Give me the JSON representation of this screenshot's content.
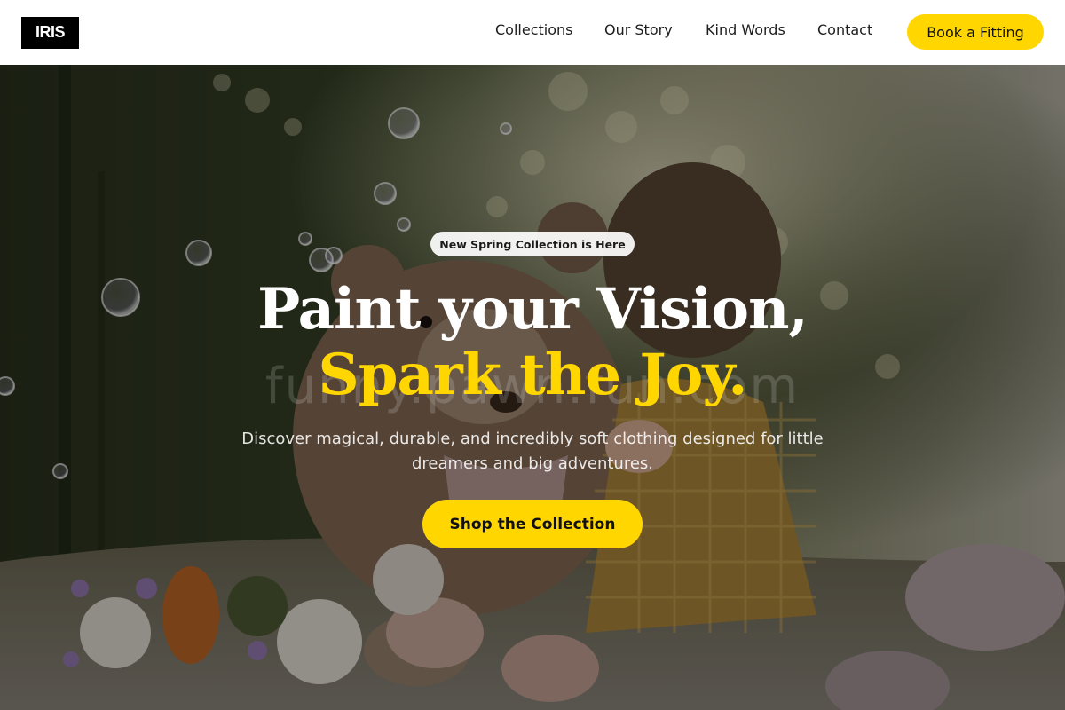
{
  "nav": {
    "logo": "IRIS",
    "links": [
      "Collections",
      "Our Story",
      "Kind Words",
      "Contact"
    ],
    "cta": "Book a Fitting"
  },
  "hero": {
    "badge": "New Spring Collection is Here",
    "headline": "Paint your Vision,",
    "headline_accent": "Spark the Joy.",
    "subtitle": "Discover magical, durable, and incredibly soft clothing designed for little dreamers and big adventures.",
    "cta": "Shop the Collection",
    "watermark": "funny.pawn.fun.com"
  },
  "colors": {
    "accent": "#ffd600",
    "nav_bg": "#ffffff",
    "logo_bg": "#000000",
    "text_dark": "#1d1d1d"
  },
  "icons": {
    "logo": "wordmark"
  }
}
